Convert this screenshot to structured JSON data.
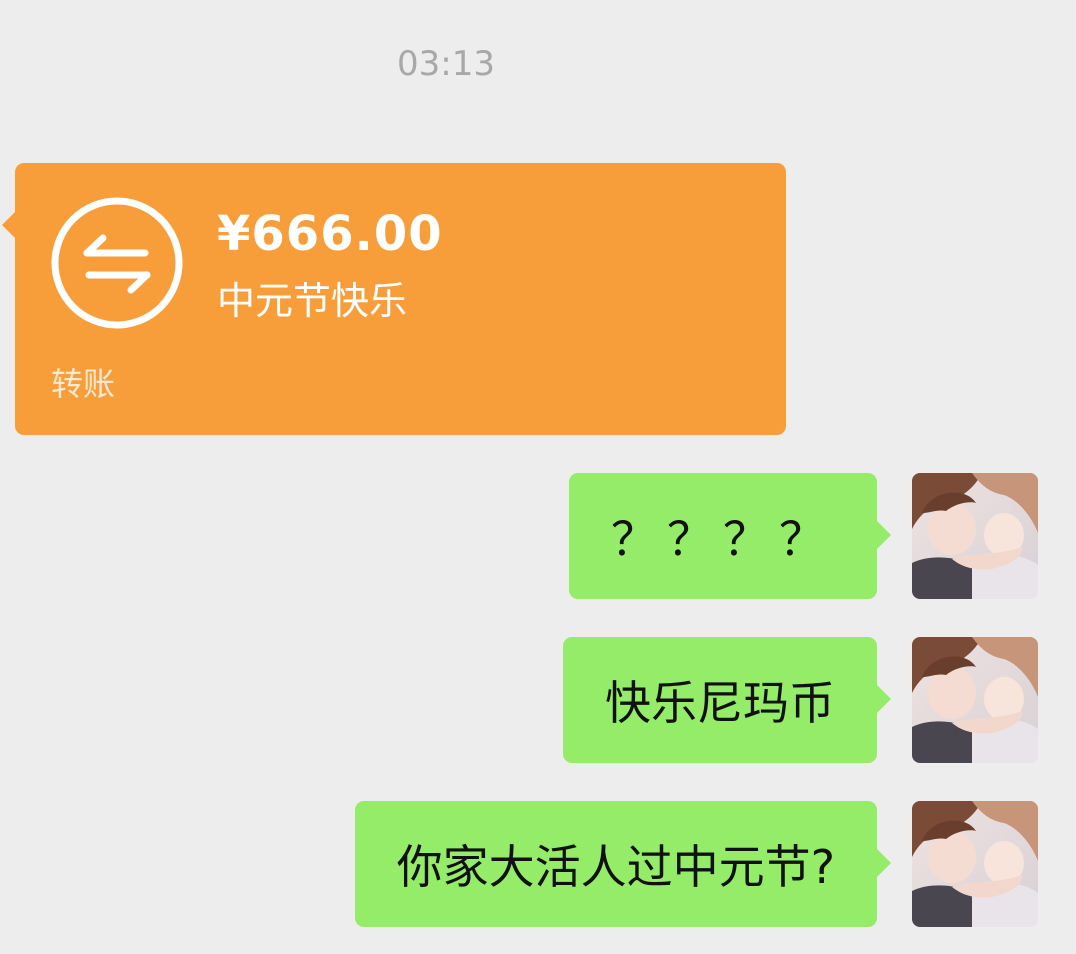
{
  "chat": {
    "timestamp": "03:13",
    "transfer": {
      "amount": "¥666.00",
      "note": "中元节快乐",
      "label": "转账",
      "icon": "transfer-arrows-icon",
      "color": "#f79e3b"
    },
    "messages": [
      {
        "text": "？？？？"
      },
      {
        "text": "快乐尼玛币"
      },
      {
        "text": "你家大活人过中元节?"
      }
    ],
    "bubble_color": "#95ec69",
    "avatar": "anime-couple-avatar"
  }
}
